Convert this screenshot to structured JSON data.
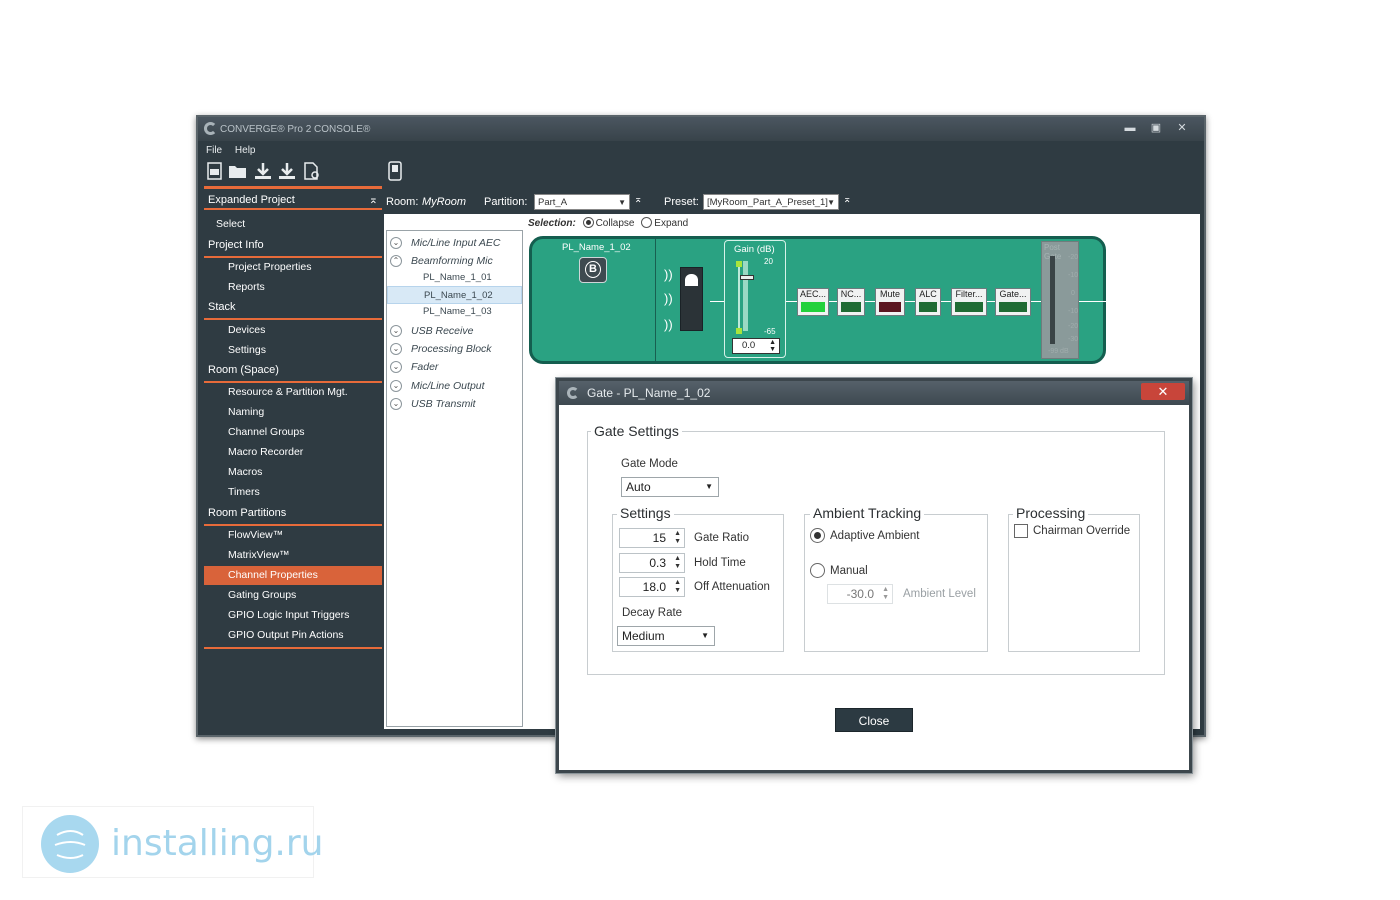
{
  "window": {
    "title": "CONVERGE® Pro 2 CONSOLE®",
    "minimize": "▬",
    "maximize": "▣",
    "close": "✕"
  },
  "menu": {
    "file": "File",
    "help": "Help"
  },
  "sidebar": {
    "header": "Expanded Project",
    "pin": "⌅",
    "select": "Select",
    "sections": [
      {
        "label": "Project Info",
        "items": [
          "Project Properties",
          "Reports"
        ]
      },
      {
        "label": "Stack",
        "items": [
          "Devices",
          "Settings"
        ]
      },
      {
        "label": "Room (Space)",
        "items": [
          "Resource & Partition Mgt.",
          "Naming",
          "Channel Groups",
          "Macro Recorder",
          "Macros",
          "Timers"
        ]
      },
      {
        "label": "Room Partitions",
        "items": [
          "FlowView™",
          "MatrixView™",
          "Channel Properties",
          "Gating Groups",
          "GPIO Logic Input Triggers",
          "GPIO Output Pin Actions"
        ]
      }
    ],
    "active_item": "Channel Properties"
  },
  "roombar": {
    "room_label": "Room:",
    "room_value": "MyRoom",
    "partition_label": "Partition:",
    "partition_value": "Part_A",
    "preset_label": "Preset:",
    "preset_value": "[MyRoom_Part_A_Preset_1]"
  },
  "selection": {
    "label": "Selection:",
    "collapse": "Collapse",
    "expand": "Expand",
    "selected": "Collapse"
  },
  "tree": [
    {
      "label": "Mic/Line Input AEC",
      "type": "group",
      "expanded": false
    },
    {
      "label": "Beamforming Mic",
      "type": "group",
      "expanded": true
    },
    {
      "label": "PL_Name_1_01",
      "type": "child"
    },
    {
      "label": "PL_Name_1_02",
      "type": "child",
      "selected": true
    },
    {
      "label": "PL_Name_1_03",
      "type": "child"
    },
    {
      "label": "USB Receive",
      "type": "group",
      "expanded": false
    },
    {
      "label": "Processing Block",
      "type": "group",
      "expanded": false
    },
    {
      "label": "Fader",
      "type": "group",
      "expanded": false
    },
    {
      "label": "Mic/Line Output",
      "type": "group",
      "expanded": false
    },
    {
      "label": "USB Transmit",
      "type": "group",
      "expanded": false
    }
  ],
  "strip": {
    "channel_name": "PL_Name_1_02",
    "badge": "B",
    "gain_label": "Gain (dB)",
    "gain_max": "20",
    "gain_min": "-65",
    "gain_value": "0.0",
    "blocks": [
      {
        "label": "AEC...",
        "led": "#22d13c"
      },
      {
        "label": "NC...",
        "led": "#1f6b34"
      },
      {
        "label": "Mute",
        "led": "#5a1520"
      },
      {
        "label": "ALC",
        "led": "#1f6b34"
      },
      {
        "label": "Filter...",
        "led": "#1f6b34"
      },
      {
        "label": "Gate...",
        "led": "#1f6b34"
      }
    ],
    "meter_label": "Post Gate",
    "meter_ticks": [
      "-20",
      "-10",
      "0",
      "-10",
      "-20",
      "-30"
    ],
    "meter_bottom": "-99 dB"
  },
  "dialog": {
    "title": "Gate - PL_Name_1_02",
    "close_x": "✕",
    "gate_settings_title": "Gate Settings",
    "gate_mode_label": "Gate Mode",
    "gate_mode_value": "Auto",
    "settings": {
      "title": "Settings",
      "gate_ratio_value": "15",
      "gate_ratio_label": "Gate Ratio",
      "hold_time_value": "0.3",
      "hold_time_label": "Hold Time",
      "off_attenuation_value": "18.0",
      "off_attenuation_label": "Off Attenuation",
      "decay_rate_label": "Decay Rate",
      "decay_rate_value": "Medium"
    },
    "ambient": {
      "title": "Ambient Tracking",
      "adaptive_label": "Adaptive Ambient",
      "manual_label": "Manual",
      "level_value": "-30.0",
      "level_label": "Ambient Level",
      "selected": "Adaptive Ambient"
    },
    "processing": {
      "title": "Processing",
      "chairman_label": "Chairman Override",
      "chairman_checked": false
    },
    "close_button": "Close"
  },
  "watermark": {
    "text": "installing.ru"
  }
}
